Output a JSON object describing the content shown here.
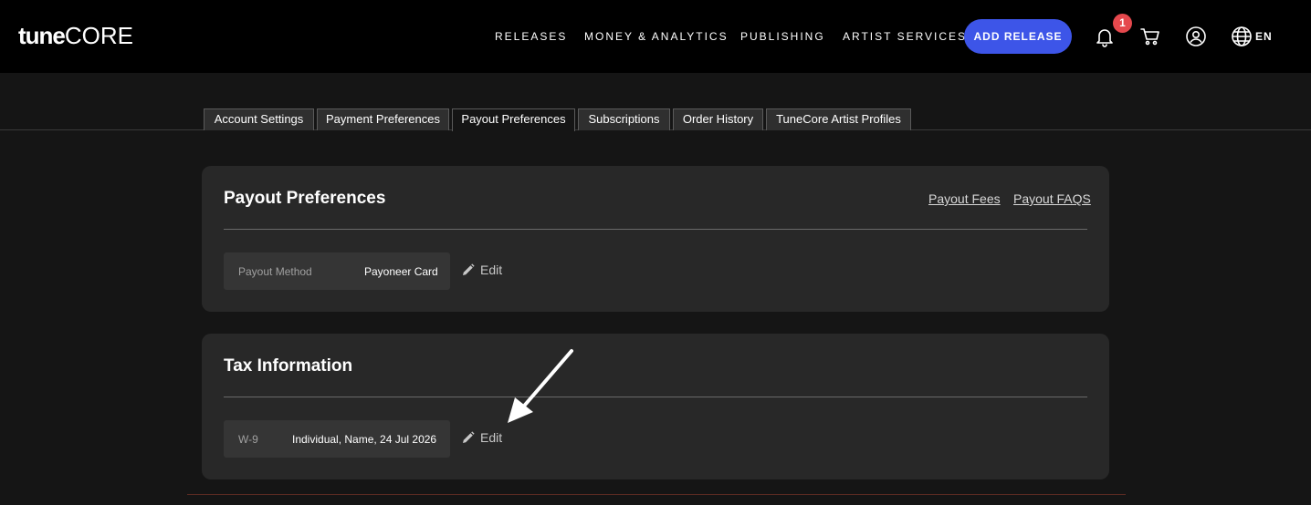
{
  "header": {
    "logo_bold": "tune",
    "logo_light": "CORE",
    "nav": [
      "RELEASES",
      "MONEY & ANALYTICS",
      "PUBLISHING",
      "ARTIST SERVICES"
    ],
    "add_release": "ADD RELEASE",
    "notification_count": "1",
    "language": "EN",
    "icons": [
      "bell-icon",
      "cart-icon",
      "user-icon",
      "globe-icon"
    ],
    "accent_color": "#3d55e8",
    "badge_color": "#e5484d"
  },
  "tabs": [
    {
      "label": "Account Settings",
      "active": false
    },
    {
      "label": "Payment Preferences",
      "active": false
    },
    {
      "label": "Payout Preferences",
      "active": true
    },
    {
      "label": "Subscriptions",
      "active": false
    },
    {
      "label": "Order History",
      "active": false
    },
    {
      "label": "TuneCore Artist Profiles",
      "active": false
    }
  ],
  "payout": {
    "title": "Payout Preferences",
    "links": [
      "Payout Fees",
      "Payout FAQS"
    ],
    "method_label": "Payout Method",
    "method_value": "Payoneer Card",
    "edit_label": "Edit"
  },
  "tax": {
    "title": "Tax Information",
    "form_label": "W-9",
    "form_value": "Individual, Name, 24 Jul 2026",
    "edit_label": "Edit"
  }
}
